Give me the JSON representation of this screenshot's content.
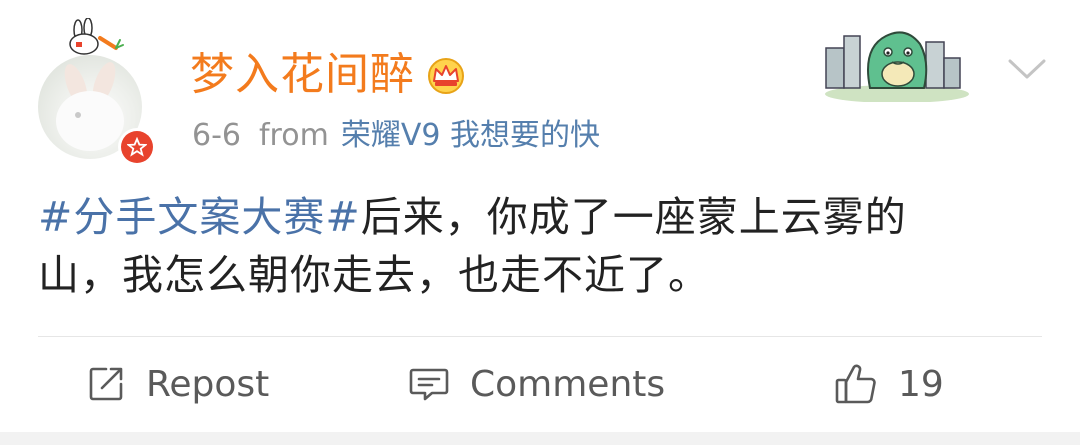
{
  "post": {
    "username": "梦入花间醉",
    "timestamp": "6-6",
    "from_label": "from",
    "device": "荣耀V9 我想要的快",
    "content": {
      "hashtag": "#分手文案大赛#",
      "line1_rest": "后来，你成了一座蒙上云雾的",
      "line2": "山，我怎么朝你走去，也走不近了。"
    }
  },
  "actions": {
    "repost_label": "Repost",
    "comments_label": "Comments",
    "like_count": "19"
  },
  "icons": {
    "verified_badge": "red-star-badge-icon",
    "vip": "crown-icon",
    "more": "chevron-down-icon",
    "repost": "share-edit-icon",
    "comments": "comment-bubble-icon",
    "like": "thumbs-up-icon"
  },
  "colors": {
    "username": "#f37b1d",
    "hashtag": "#4a72a8",
    "device": "#557fad",
    "meta": "#939393",
    "badge": "#e8432d"
  }
}
